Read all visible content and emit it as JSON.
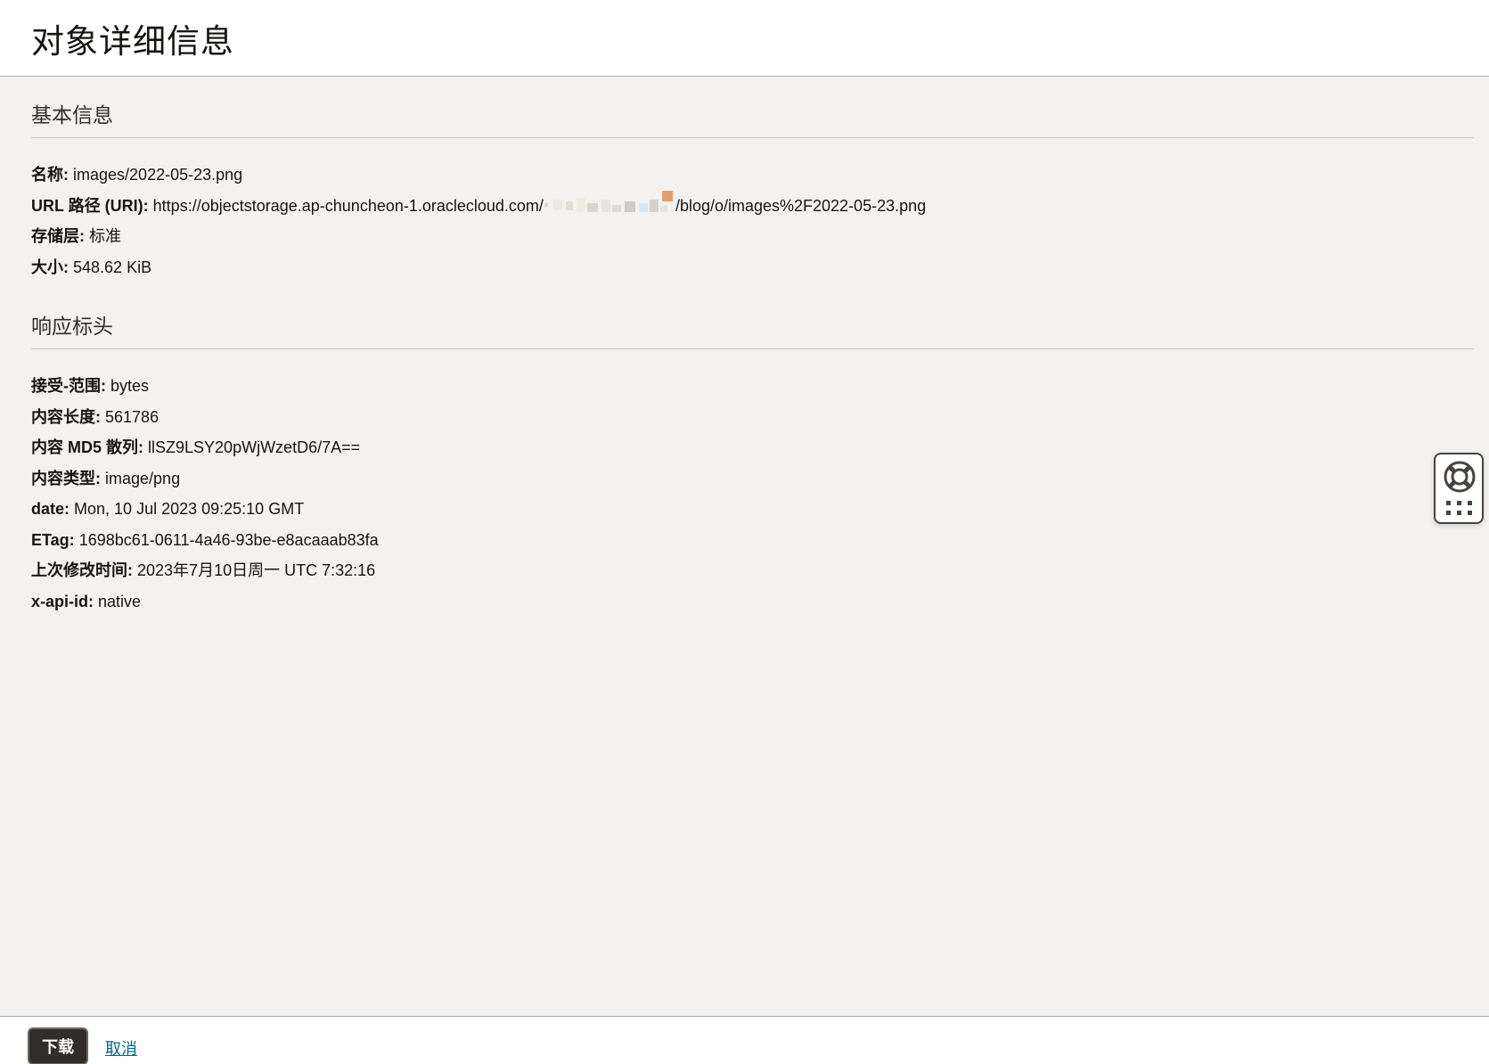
{
  "page": {
    "title": "对象详细信息"
  },
  "basic_info": {
    "heading": "基本信息",
    "fields": [
      {
        "label": "名称:",
        "value": "images/2022-05-23.png"
      },
      {
        "label": "URL 路径 (URI):",
        "value_prefix": "https://objectstorage.ap-chuncheon-1.oraclecloud.com/",
        "value_suffix": "/blog/o/images%2F2022-05-23.png"
      },
      {
        "label": "存储层:",
        "value": "标准"
      },
      {
        "label": "大小:",
        "value": "548.62 KiB"
      }
    ]
  },
  "response_headers": {
    "heading": "响应标头",
    "fields": [
      {
        "label": "接受-范围:",
        "value": "bytes"
      },
      {
        "label": "内容长度:",
        "value": "561786"
      },
      {
        "label": "内容 MD5 散列:",
        "value": "llSZ9LSY20pWjWzetD6/7A=="
      },
      {
        "label": "内容类型:",
        "value": "image/png"
      },
      {
        "label": "date:",
        "value": "Mon, 10 Jul 2023 09:25:10 GMT"
      },
      {
        "label": "ETag:",
        "value": "1698bc61-0611-4a46-93be-e8acaaab83fa"
      },
      {
        "label": "上次修改时间:",
        "value": "2023年7月10日周一 UTC 7:32:16"
      },
      {
        "label": "x-api-id:",
        "value": "native"
      }
    ]
  },
  "help_widget": {
    "icons": [
      "lifebuoy-icon",
      "apps-grid-icon"
    ]
  },
  "footer": {
    "download_label": "下载",
    "cancel_label": "取消"
  },
  "colors": {
    "background": "#f3f2f1",
    "header_bg": "#ffffff",
    "primary_button": "#312d2a",
    "link": "#00688c"
  }
}
